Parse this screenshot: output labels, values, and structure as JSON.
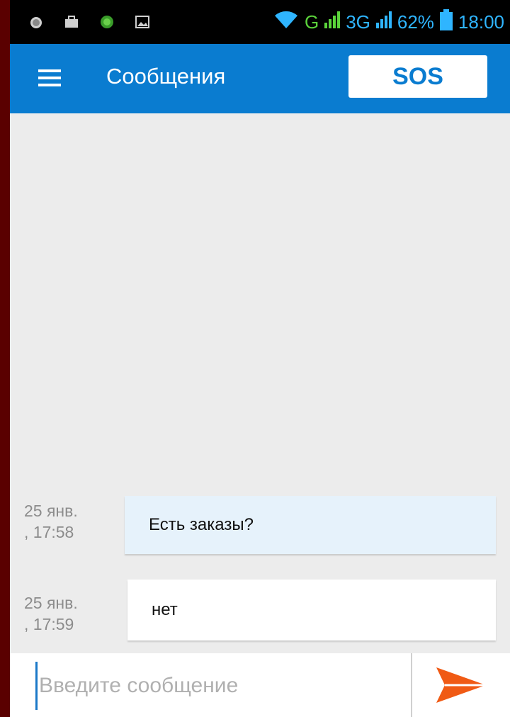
{
  "status_bar": {
    "icons_left": [
      "alarm-icon",
      "briefcase-icon",
      "app-icon",
      "gallery-icon"
    ],
    "network": "G",
    "network2": "3G",
    "battery": "62%",
    "time": "18:00",
    "colors": {
      "green": "#5bd33b",
      "blue": "#2fb5ff"
    }
  },
  "appbar": {
    "title": "Сообщения",
    "sos_label": "SOS",
    "color": "#0a7cd0"
  },
  "messages": [
    {
      "time": "25 янв.\n, 17:58",
      "text": "Есть заказы?",
      "type": "sent"
    },
    {
      "time": "25 янв.\n, 17:59",
      "text": "нет",
      "type": "received"
    }
  ],
  "input": {
    "placeholder": "Введите сообщение",
    "value": "",
    "send_color": "#f05a14"
  }
}
